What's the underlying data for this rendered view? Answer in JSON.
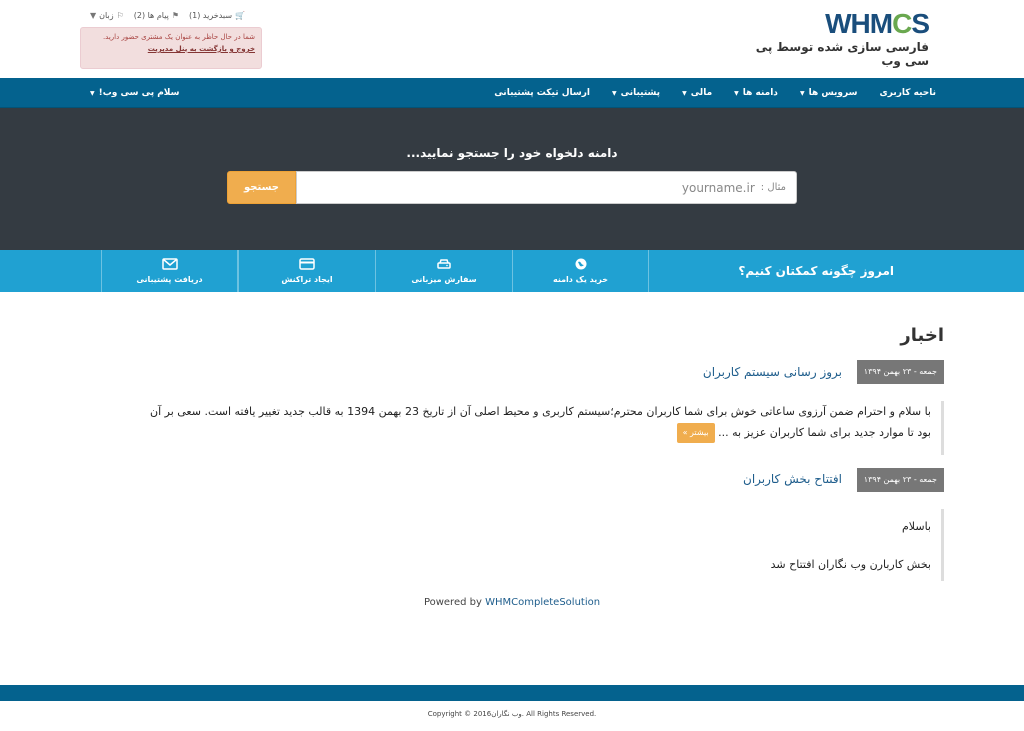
{
  "header": {
    "logo_text": "WHMCS",
    "logo_left": "WHM",
    "logo_o": "C",
    "logo_right": "S",
    "logo_subtitle": "فارسی سازی شده توسط پی سی وب",
    "top_links": {
      "cart": "سبدخرید (1)",
      "messages": "پیام ها (2)",
      "language": "زبان"
    },
    "admin_alert": {
      "text": "شما در حال حاظر به عنوان یک مشتری حضور دارید.",
      "back_link": "خروج و بازگشت به پنل مدیریت"
    }
  },
  "nav": {
    "items": [
      {
        "label": "ناحیه کاربری",
        "caret": false
      },
      {
        "label": "سرویس ها",
        "caret": true
      },
      {
        "label": "دامنه ها",
        "caret": true
      },
      {
        "label": "مالی",
        "caret": true
      },
      {
        "label": "پشتیبانی",
        "caret": true
      },
      {
        "label": "ارسال تیکت پشتیبانی",
        "caret": false
      }
    ],
    "account_label": "سلام پی سی وب!"
  },
  "search": {
    "title": "دامنه دلخواه خود را جستجو نمایید...",
    "example_prefix": "مثال :",
    "placeholder_value": "yourname.ir",
    "button": "جستجو"
  },
  "help": {
    "title": "امروز چگونه کمکتان کنیم؟",
    "boxes": [
      {
        "label": "خرید یک دامنه",
        "icon": "globe-icon"
      },
      {
        "label": "سفارش میزبانی",
        "icon": "server-icon"
      },
      {
        "label": "ایجاد تراکنش",
        "icon": "credit-card-icon"
      },
      {
        "label": "دریافت پشتیبانی",
        "icon": "envelope-icon"
      }
    ]
  },
  "news": {
    "heading": "اخبار",
    "items": [
      {
        "date": "جمعه - ۲۳ بهمن ۱۳۹۴",
        "title": "بروز رسانی سیستم کاربران",
        "body_line1": "با سلام و احترام ضمن آرزوی ساعاتی خوش برای شما کاربران محترم؛سیستم کاربری و محیط اصلی آن از تاریخ 23 بهمن 1394 به قالب جدید تغییر یافته است. سعی بر آن",
        "body_line2": "بود تا موارد جدید برای شما کاربران عزیز به ...",
        "more": "بیشتر »"
      },
      {
        "date": "جمعه - ۲۳ بهمن ۱۳۹۴",
        "title": "افتتاح بخش کاربران",
        "body_line1": "باسلام",
        "body_line2": "بخش کاربارن وب نگاران افتتاح شد"
      }
    ]
  },
  "powered": {
    "prefix": "Powered by",
    "link": "WHMCompleteSolution"
  },
  "footer": {
    "copyright": "Copyright © 2016وب نگاران. All Rights Reserved."
  },
  "colors": {
    "navbar": "#04628e",
    "hero": "#343b42",
    "helpbar": "#20a1d2",
    "accent": "#f0ad4e"
  }
}
